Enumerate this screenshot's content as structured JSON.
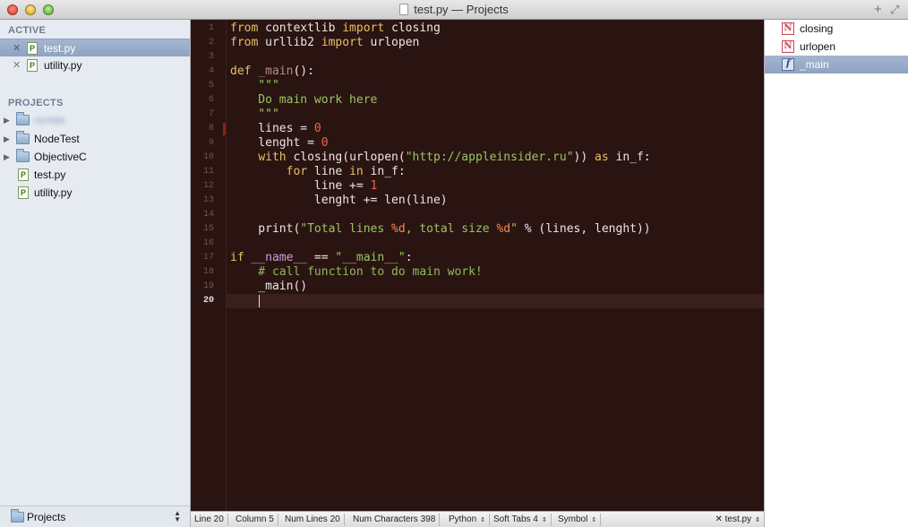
{
  "window": {
    "title": "test.py — Projects"
  },
  "sidebar": {
    "active_header": "ACTIVE",
    "active_files": [
      {
        "label": "test.py",
        "icon": "python-file-icon",
        "selected": true
      },
      {
        "label": "utility.py",
        "icon": "python-file-icon",
        "selected": false
      }
    ],
    "projects_header": "PROJECTS",
    "project_items": [
      {
        "label": "nimble",
        "type": "folder",
        "blurred": true
      },
      {
        "label": "NodeTest",
        "type": "folder"
      },
      {
        "label": "ObjectiveC",
        "type": "folder"
      },
      {
        "label": "test.py",
        "type": "file"
      },
      {
        "label": "utility.py",
        "type": "file"
      }
    ],
    "footer_label": "Projects"
  },
  "editor": {
    "line_numbers": [
      "1",
      "2",
      "3",
      "4",
      "5",
      "6",
      "7",
      "8",
      "9",
      "10",
      "11",
      "12",
      "13",
      "14",
      "15",
      "16",
      "17",
      "18",
      "19",
      "20"
    ],
    "current_line": 20,
    "marked_line": 8
  },
  "statusbar": {
    "line": "Line 20",
    "column": "Column 5",
    "num_lines": "Num Lines 20",
    "num_chars": "Num Characters 398",
    "language": "Python",
    "tabs": "Soft Tabs 4",
    "symbol": "Symbol",
    "file": "test.py"
  },
  "symbols": [
    {
      "label": "closing",
      "icon": "N",
      "kind": "import-symbol-icon",
      "selected": false
    },
    {
      "label": "urlopen",
      "icon": "N",
      "kind": "import-symbol-icon",
      "selected": false
    },
    {
      "label": "_main",
      "icon": "f",
      "kind": "function-symbol-icon",
      "selected": true
    }
  ],
  "code": {
    "l1": [
      "from",
      " contextlib ",
      "import",
      " closing"
    ],
    "l2": [
      "from",
      " urllib2 ",
      "import",
      " urlopen"
    ],
    "l4": [
      "def",
      " ",
      "_main",
      "():"
    ],
    "l5": "    \"\"\"",
    "l6": "    Do main work here",
    "l7": "    \"\"\"",
    "l8": [
      "    lines = ",
      "0"
    ],
    "l9": [
      "    lenght = ",
      "0"
    ],
    "l10": [
      "    ",
      "with",
      " closing(urlopen(",
      "\"http://appleinsider.ru\"",
      ")) ",
      "as",
      " in_f:"
    ],
    "l11": [
      "        ",
      "for",
      " line ",
      "in",
      " in_f:"
    ],
    "l12": [
      "            line += ",
      "1"
    ],
    "l13": [
      "            lenght += len(line)"
    ],
    "l15": [
      "    print(",
      "\"Total lines ",
      "%d",
      ", total size ",
      "%d",
      "\"",
      " % (lines, lenght))"
    ],
    "l17": [
      "if",
      " ",
      "__name__",
      " == ",
      "\"__main__\"",
      ":"
    ],
    "l18": "    # call function to do main work!",
    "l19": "    _main()"
  },
  "colors": {
    "editor_bg": "#2a1412",
    "keyword": "#e8c062",
    "string": "#98c661",
    "number": "#f55f48",
    "selection": "#8ea3c2"
  }
}
